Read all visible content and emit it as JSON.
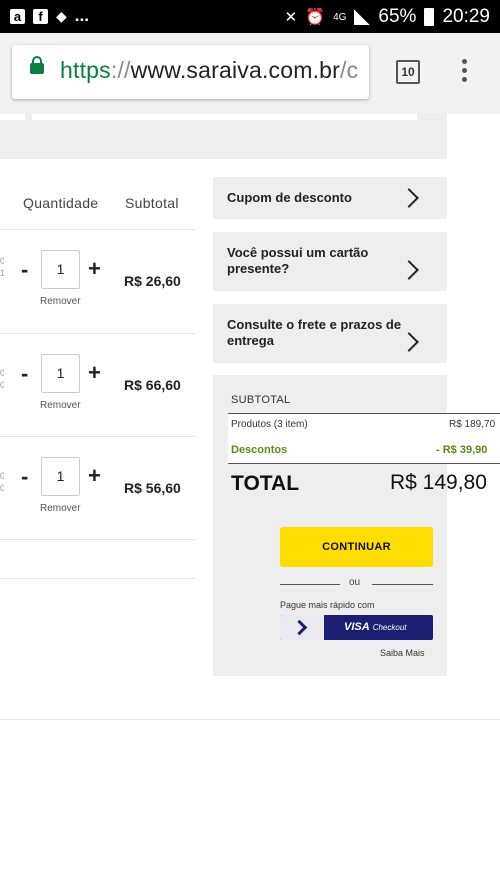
{
  "status_bar": {
    "left_icons": [
      "amazon-icon",
      "facebook-icon",
      "dropbox-icon"
    ],
    "overflow": "...",
    "network": "4G",
    "battery": "65%",
    "time": "20:29"
  },
  "browser": {
    "url_scheme": "https",
    "url_separator": "://",
    "url_host": "www.saraiva.com.br",
    "url_rest": "/c",
    "tab_count": "10"
  },
  "cart": {
    "headers": {
      "quantity": "Quantidade",
      "subtotal": "Subtotal"
    },
    "items": [
      {
        "quantity": "1",
        "minus": "-",
        "plus": "+",
        "remove": "Remover",
        "price": "R$ 26,60"
      },
      {
        "quantity": "1",
        "minus": "-",
        "plus": "+",
        "remove": "Remover",
        "price": "R$ 66,60"
      },
      {
        "quantity": "1",
        "minus": "-",
        "plus": "+",
        "remove": "Remover",
        "price": "R$ 56,60"
      }
    ]
  },
  "sidebar": {
    "coupon": "Cupom de desconto",
    "gift_card": "Você possui um cartão presente?",
    "shipping": "Consulte o frete e prazos de entrega"
  },
  "summary": {
    "title": "SUBTOTAL",
    "products_label": "Produtos (3 item)",
    "products_value": "R$ 189,70",
    "discount_label": "Descontos",
    "discount_value": "- R$ 39,90",
    "total_label": "TOTAL",
    "total_value": "R$ 149,80",
    "continue_button": "CONTINUAR",
    "or": "ou",
    "pay_faster": "Pague mais rápido com",
    "visa_brand": "VISA",
    "visa_checkout": "Checkout",
    "learn_more": "Saiba Mais"
  },
  "colors": {
    "accent_yellow": "#ffdd00",
    "discount_green": "#5b8a17",
    "secure_green": "#0b8043",
    "visa_blue": "#1a1f71"
  }
}
